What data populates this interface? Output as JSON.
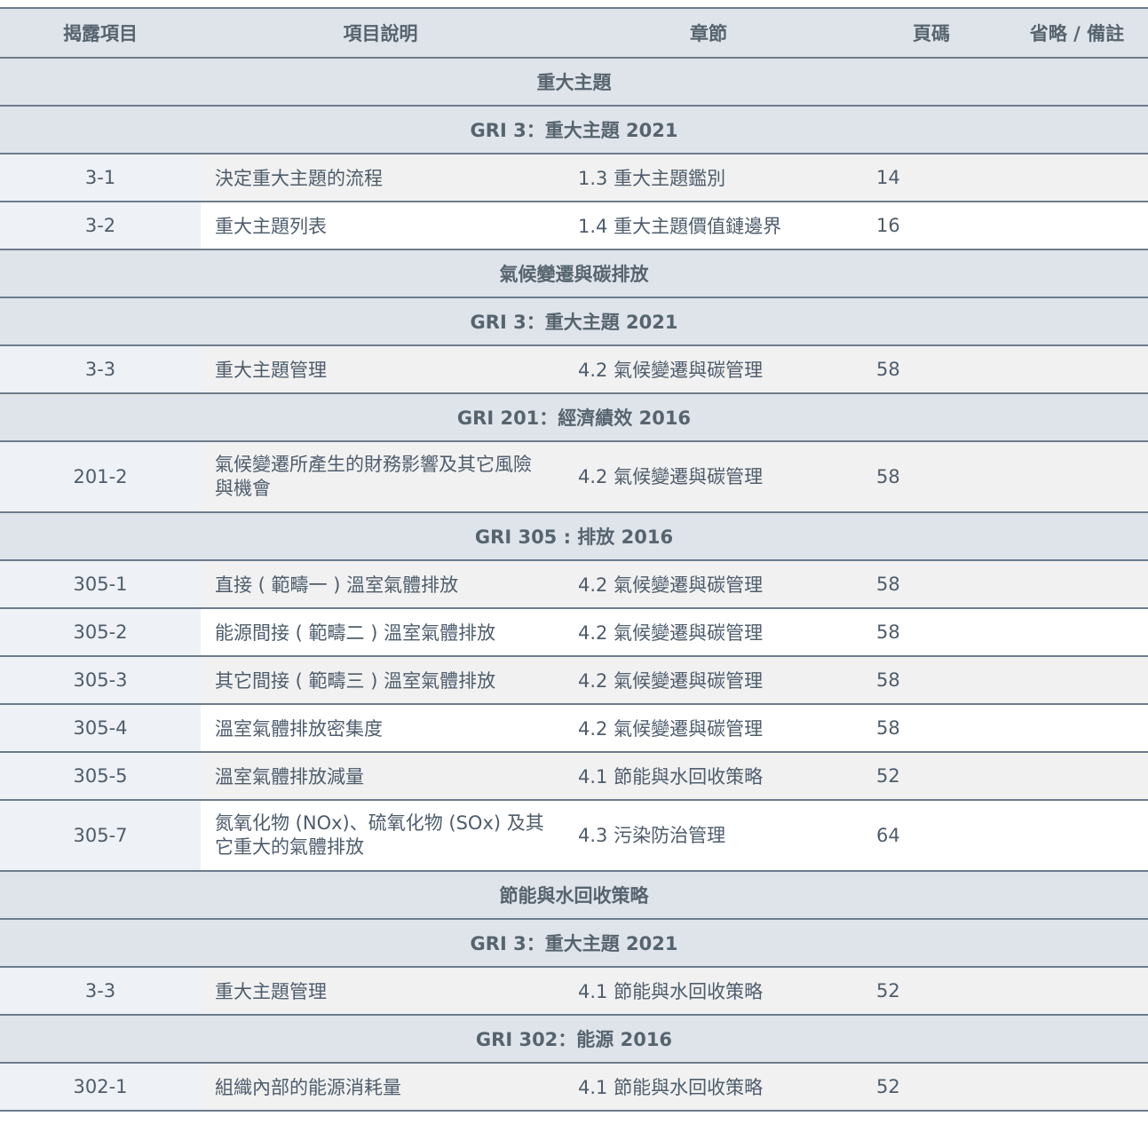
{
  "header": {
    "code": "揭露項目",
    "description": "項目說明",
    "chapter": "章節",
    "page": "頁碼",
    "note": "省略 / 備註"
  },
  "rows": [
    {
      "type": "section",
      "text": "重大主題"
    },
    {
      "type": "section",
      "text": "GRI 3：重大主題 2021"
    },
    {
      "type": "item",
      "code": "3-1",
      "description": "決定重大主題的流程",
      "chapter": "1.3 重大主題鑑別",
      "page": "14",
      "note": ""
    },
    {
      "type": "item",
      "code": "3-2",
      "description": "重大主題列表",
      "chapter": "1.4 重大主題價值鏈邊界",
      "page": "16",
      "note": ""
    },
    {
      "type": "section",
      "text": "氣候變遷與碳排放"
    },
    {
      "type": "section",
      "text": "GRI 3：重大主題 2021"
    },
    {
      "type": "item",
      "code": "3-3",
      "description": "重大主題管理",
      "chapter": "4.2 氣候變遷與碳管理",
      "page": "58",
      "note": ""
    },
    {
      "type": "section",
      "text": "GRI 201：經濟績效 2016"
    },
    {
      "type": "item",
      "code": "201-2",
      "description": "氣候變遷所產生的財務影響及其它風險與機會",
      "chapter": "4.2 氣候變遷與碳管理",
      "page": "58",
      "note": ""
    },
    {
      "type": "section",
      "text": "GRI 305 : 排放 2016"
    },
    {
      "type": "item",
      "code": "305-1",
      "description": "直接 ( 範疇一 ) 溫室氣體排放",
      "chapter": "4.2 氣候變遷與碳管理",
      "page": "58",
      "note": ""
    },
    {
      "type": "item",
      "code": "305-2",
      "description": "能源間接 ( 範疇二 ) 溫室氣體排放",
      "chapter": "4.2 氣候變遷與碳管理",
      "page": "58",
      "note": ""
    },
    {
      "type": "item",
      "code": "305-3",
      "description": "其它間接 ( 範疇三 ) 溫室氣體排放",
      "chapter": "4.2 氣候變遷與碳管理",
      "page": "58",
      "note": ""
    },
    {
      "type": "item",
      "code": "305-4",
      "description": "溫室氣體排放密集度",
      "chapter": "4.2 氣候變遷與碳管理",
      "page": "58",
      "note": ""
    },
    {
      "type": "item",
      "code": "305-5",
      "description": "溫室氣體排放減量",
      "chapter": "4.1 節能與水回收策略",
      "page": "52",
      "note": ""
    },
    {
      "type": "item",
      "code": "305-7",
      "description": "氮氧化物 (NOx)、硫氧化物 (SOx) 及其它重大的氣體排放",
      "chapter": "4.3 污染防治管理",
      "page": "64",
      "note": ""
    },
    {
      "type": "section",
      "text": "節能與水回收策略"
    },
    {
      "type": "section",
      "text": "GRI 3：重大主題 2021"
    },
    {
      "type": "item",
      "code": "3-3",
      "description": "重大主題管理",
      "chapter": "4.1 節能與水回收策略",
      "page": "52",
      "note": ""
    },
    {
      "type": "section",
      "text": "GRI 302：能源 2016"
    },
    {
      "type": "item",
      "code": "302-1",
      "description": "組織內部的能源消耗量",
      "chapter": "4.1 節能與水回收策略",
      "page": "52",
      "note": ""
    }
  ]
}
